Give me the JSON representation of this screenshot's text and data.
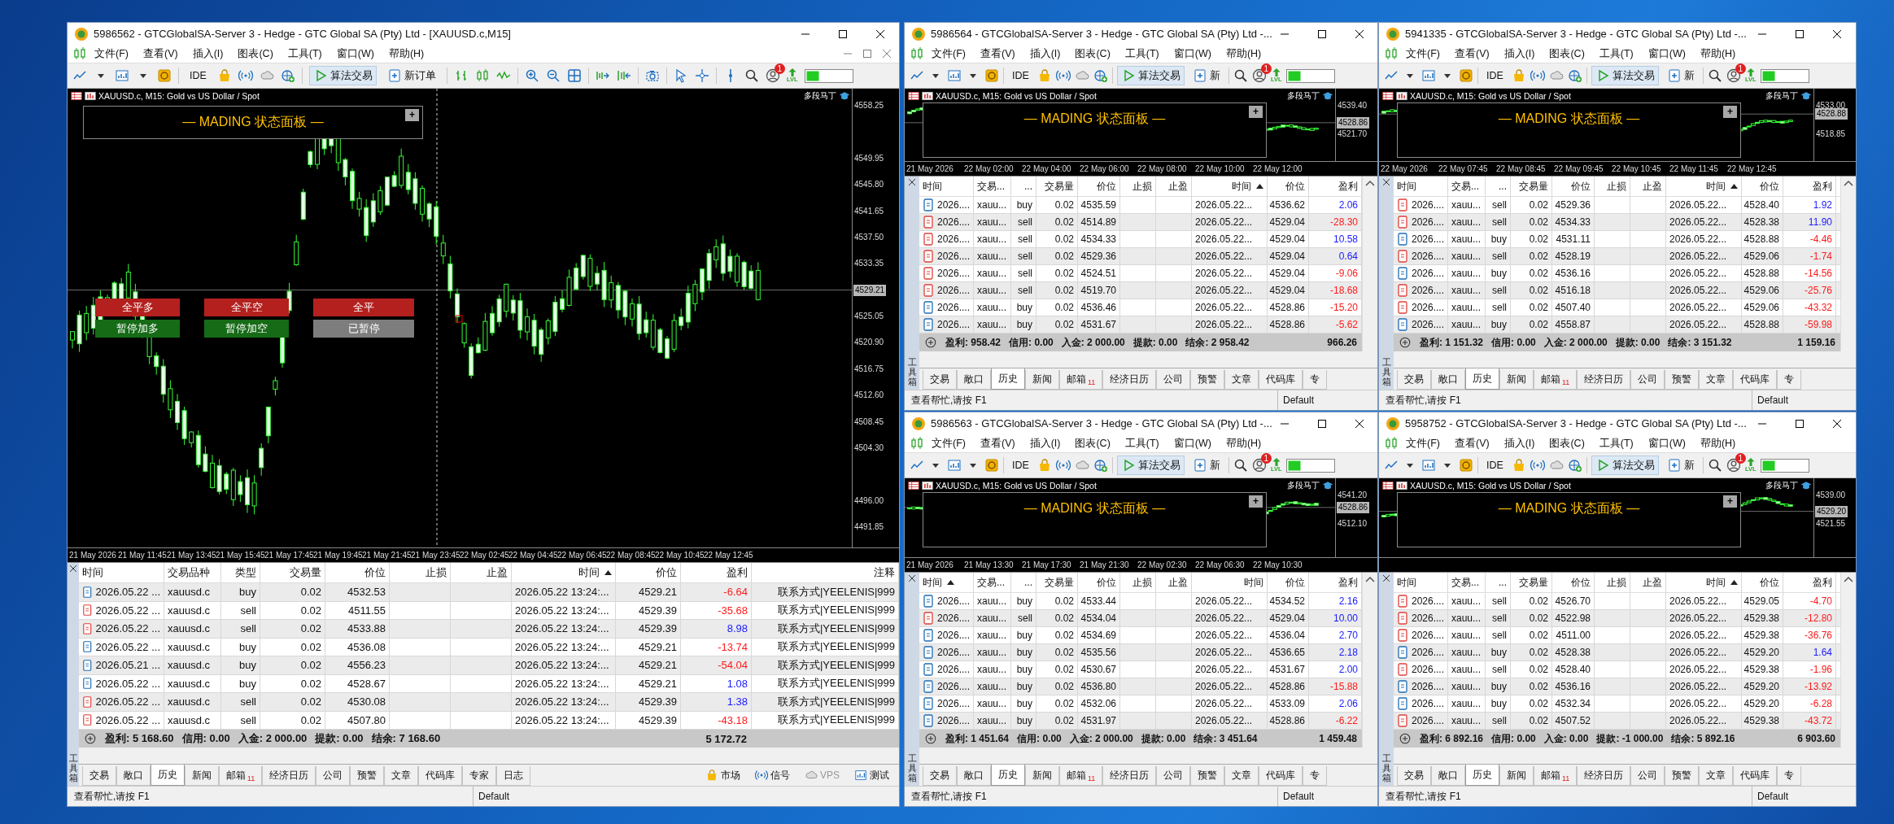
{
  "windows": [
    {
      "kind": "main",
      "title": "5986562 - GTCGlobalSA-Server 3 - Hedge - GTC Global SA (Pty) Ltd - [XAUUSD.c,M15]",
      "menu": [
        "文件(F)",
        "查看(V)",
        "插入(I)",
        "图表(C)",
        "工具(T)",
        "窗口(W)",
        "帮助(H)"
      ],
      "toolbar": {
        "ide": "IDE",
        "algo": "算法交易",
        "order": "新订单",
        "notifications": "1",
        "lvl": "LVL"
      },
      "chart": {
        "symbol": "XAUUSD.c, M15:  Gold vs US Dollar / Spot",
        "expert": "多段马丁",
        "panel_title": "— MADING 状态面板 —",
        "panel_button": "+",
        "prices": [
          "4558.25",
          "4549.95",
          "4545.80",
          "4541.65",
          "4537.50",
          "4533.35",
          "4525.05",
          "4520.90",
          "4516.75",
          "4512.60",
          "4508.45",
          "4504.30",
          "4496.00",
          "4491.85"
        ],
        "current_price": "4529.21",
        "times": [
          "21 May 2026",
          "21 May 11:45",
          "21 May 13:45",
          "21 May 15:45",
          "21 May 17:45",
          "21 May 19:45",
          "21 May 21:45",
          "21 May 23:45",
          "22 May 02:45",
          "22 May 04:45",
          "22 May 06:45",
          "22 May 08:45",
          "22 May 10:45",
          "22 May 12:45"
        ],
        "buttons": [
          {
            "label": "全平多",
            "kind": "close"
          },
          {
            "label": "全平空",
            "kind": "close"
          },
          {
            "label": "全平",
            "kind": "close"
          },
          {
            "label": "暂停加多",
            "kind": "pause"
          },
          {
            "label": "暂停加空",
            "kind": "pause"
          },
          {
            "label": "已暂停",
            "kind": "paused"
          }
        ]
      },
      "table": {
        "columns": [
          {
            "label": "时间",
            "sorted": false
          },
          {
            "label": "交易品种",
            "sorted": false
          },
          {
            "label": "类型",
            "sorted": false
          },
          {
            "label": "交易量",
            "sorted": false
          },
          {
            "label": "价位",
            "sorted": false
          },
          {
            "label": "止损",
            "sorted": false
          },
          {
            "label": "止盈",
            "sorted": false
          },
          {
            "label": "时间",
            "sorted": true
          },
          {
            "label": "价位",
            "sorted": false
          },
          {
            "label": "盈利",
            "sorted": false
          },
          {
            "label": "注释",
            "sorted": false
          }
        ],
        "rows": [
          {
            "time": "2026.05.22 ...",
            "symbol": "xauusd.c",
            "type": "buy",
            "long": true,
            "volume": "0.02",
            "price": "4532.53",
            "close_time": "2026.05.22 13:24:...",
            "close_price": "4529.21",
            "profit": "-6.64",
            "loss": true,
            "comment": "联系方式|YEELENIS|999"
          },
          {
            "time": "2026.05.22 ...",
            "symbol": "xauusd.c",
            "type": "sell",
            "long": false,
            "volume": "0.02",
            "price": "4511.55",
            "close_time": "2026.05.22 13:24:...",
            "close_price": "4529.39",
            "profit": "-35.68",
            "loss": true,
            "comment": "联系方式|YEELENIS|999"
          },
          {
            "time": "2026.05.22 ...",
            "symbol": "xauusd.c",
            "type": "sell",
            "long": false,
            "volume": "0.02",
            "price": "4533.88",
            "close_time": "2026.05.22 13:24:...",
            "close_price": "4529.39",
            "profit": "8.98",
            "loss": false,
            "comment": "联系方式|YEELENIS|999"
          },
          {
            "time": "2026.05.22 ...",
            "symbol": "xauusd.c",
            "type": "buy",
            "long": true,
            "volume": "0.02",
            "price": "4536.08",
            "close_time": "2026.05.22 13:24:...",
            "close_price": "4529.21",
            "profit": "-13.74",
            "loss": true,
            "comment": "联系方式|YEELENIS|999"
          },
          {
            "time": "2026.05.21 ...",
            "symbol": "xauusd.c",
            "type": "buy",
            "long": true,
            "volume": "0.02",
            "price": "4556.23",
            "close_time": "2026.05.22 13:24:...",
            "close_price": "4529.21",
            "profit": "-54.04",
            "loss": true,
            "comment": "联系方式|YEELENIS|999"
          },
          {
            "time": "2026.05.22 ...",
            "symbol": "xauusd.c",
            "type": "buy",
            "long": true,
            "volume": "0.02",
            "price": "4528.67",
            "close_time": "2026.05.22 13:24:...",
            "close_price": "4529.21",
            "profit": "1.08",
            "loss": false,
            "comment": "联系方式|YEELENIS|999"
          },
          {
            "time": "2026.05.22 ...",
            "symbol": "xauusd.c",
            "type": "sell",
            "long": false,
            "volume": "0.02",
            "price": "4530.08",
            "close_time": "2026.05.22 13:24:...",
            "close_price": "4529.39",
            "profit": "1.38",
            "loss": false,
            "comment": "联系方式|YEELENIS|999"
          },
          {
            "time": "2026.05.22 ...",
            "symbol": "xauusd.c",
            "type": "sell",
            "long": false,
            "volume": "0.02",
            "price": "4507.80",
            "close_time": "2026.05.22 13:24:...",
            "close_price": "4529.39",
            "profit": "-43.18",
            "loss": true,
            "comment": "联系方式|YEELENIS|999"
          }
        ],
        "summary": [
          "盈利: 5 168.60",
          "信用: 0.00",
          "入金: 2 000.00",
          "提款: 0.00",
          "结余: 7 168.60"
        ],
        "total": "5 172.72"
      },
      "toolbox": "工具箱",
      "tabs": [
        {
          "label": "交易",
          "selected": false
        },
        {
          "label": "敞口",
          "selected": false
        },
        {
          "label": "历史",
          "selected": true
        },
        {
          "label": "新闻",
          "selected": false
        },
        {
          "label": "邮箱",
          "badge": "11",
          "selected": false
        },
        {
          "label": "经济日历",
          "selected": false
        },
        {
          "label": "公司",
          "selected": false
        },
        {
          "label": "预警",
          "selected": false
        },
        {
          "label": "文章",
          "selected": false
        },
        {
          "label": "代码库",
          "selected": false
        },
        {
          "label": "专家",
          "selected": false
        },
        {
          "label": "日志",
          "selected": false
        }
      ],
      "side_tabs": [
        {
          "label": "市场",
          "disabled": false
        },
        {
          "label": "信号",
          "disabled": false
        },
        {
          "label": "VPS",
          "disabled": true
        },
        {
          "label": "测试",
          "disabled": false
        }
      ],
      "status": {
        "help": "查看帮忙,请按 F1",
        "profile": "Default"
      }
    },
    {
      "kind": "small",
      "title": "5986564 - GTCGlobalSA-Server 3 - Hedge - GTC Global SA (Pty) Ltd -...",
      "menu": [
        "文件(F)",
        "查看(V)",
        "插入(I)",
        "图表(C)",
        "工具(T)",
        "窗口(W)",
        "帮助(H)"
      ],
      "toolbar": {
        "ide": "IDE",
        "algo": "算法交易",
        "order": "新",
        "notifications": "1",
        "lvl": "LVL"
      },
      "chart": {
        "symbol": "XAUUSD.c, M15:  Gold vs US Dollar / Spot",
        "expert": "多段马丁",
        "panel_title": "— MADING 状态面板 —",
        "panel_button": "+",
        "prices": [
          "4539.40",
          "4521.70"
        ],
        "current_price": "4528.86",
        "times": [
          "21 May 2026",
          "22 May 02:00",
          "22 May 04:00",
          "22 May 06:00",
          "22 May 08:00",
          "22 May 10:00",
          "22 May 12:00"
        ]
      },
      "table": {
        "columns": [
          {
            "label": "时间",
            "sorted": false
          },
          {
            "label": "交易...",
            "sorted": false
          },
          {
            "label": "...",
            "sorted": false
          },
          {
            "label": "交易量",
            "sorted": false
          },
          {
            "label": "价位",
            "sorted": false
          },
          {
            "label": "止损",
            "sorted": false
          },
          {
            "label": "止盈",
            "sorted": false
          },
          {
            "label": "时间",
            "sorted": true
          },
          {
            "label": "价位",
            "sorted": false
          },
          {
            "label": "盈利",
            "sorted": false
          }
        ],
        "rows": [
          {
            "time": "2026....",
            "symbol": "xauu...",
            "type": "buy",
            "long": true,
            "volume": "0.02",
            "price": "4535.59",
            "close_time": "2026.05.22...",
            "close_price": "4536.62",
            "profit": "2.06",
            "loss": false
          },
          {
            "time": "2026....",
            "symbol": "xauu...",
            "type": "sell",
            "long": false,
            "volume": "0.02",
            "price": "4514.89",
            "close_time": "2026.05.22...",
            "close_price": "4529.04",
            "profit": "-28.30",
            "loss": true
          },
          {
            "time": "2026....",
            "symbol": "xauu...",
            "type": "sell",
            "long": false,
            "volume": "0.02",
            "price": "4534.33",
            "close_time": "2026.05.22...",
            "close_price": "4529.04",
            "profit": "10.58",
            "loss": false
          },
          {
            "time": "2026....",
            "symbol": "xauu...",
            "type": "sell",
            "long": false,
            "volume": "0.02",
            "price": "4529.36",
            "close_time": "2026.05.22...",
            "close_price": "4529.04",
            "profit": "0.64",
            "loss": false
          },
          {
            "time": "2026....",
            "symbol": "xauu...",
            "type": "sell",
            "long": false,
            "volume": "0.02",
            "price": "4524.51",
            "close_time": "2026.05.22...",
            "close_price": "4529.04",
            "profit": "-9.06",
            "loss": true
          },
          {
            "time": "2026....",
            "symbol": "xauu...",
            "type": "sell",
            "long": false,
            "volume": "0.02",
            "price": "4519.70",
            "close_time": "2026.05.22...",
            "close_price": "4529.04",
            "profit": "-18.68",
            "loss": true
          },
          {
            "time": "2026....",
            "symbol": "xauu...",
            "type": "buy",
            "long": true,
            "volume": "0.02",
            "price": "4536.46",
            "close_time": "2026.05.22...",
            "close_price": "4528.86",
            "profit": "-15.20",
            "loss": true
          },
          {
            "time": "2026....",
            "symbol": "xauu...",
            "type": "buy",
            "long": true,
            "volume": "0.02",
            "price": "4531.67",
            "close_time": "2026.05.22...",
            "close_price": "4528.86",
            "profit": "-5.62",
            "loss": true
          }
        ],
        "summary": [
          "盈利: 958.42",
          "信用: 0.00",
          "入金: 2 000.00",
          "提款: 0.00",
          "结余: 2 958.42"
        ],
        "total": "966.26"
      },
      "toolbox": "工具箱",
      "tabs": [
        {
          "label": "交易",
          "selected": false
        },
        {
          "label": "敞口",
          "selected": false
        },
        {
          "label": "历史",
          "selected": true
        },
        {
          "label": "新闻",
          "selected": false
        },
        {
          "label": "邮箱",
          "badge": "11",
          "selected": false
        },
        {
          "label": "经济日历",
          "selected": false
        },
        {
          "label": "公司",
          "selected": false
        },
        {
          "label": "预警",
          "selected": false
        },
        {
          "label": "文章",
          "selected": false
        },
        {
          "label": "代码库",
          "selected": false
        },
        {
          "label": "专",
          "selected": false
        }
      ],
      "status": {
        "help": "查看帮忙,请按 F1",
        "profile": "Default"
      }
    },
    {
      "kind": "small",
      "title": "5941335 - GTCGlobalSA-Server 3 - Hedge - GTC Global SA (Pty) Ltd -...",
      "menu": [
        "文件(F)",
        "查看(V)",
        "插入(I)",
        "图表(C)",
        "工具(T)",
        "窗口(W)",
        "帮助(H)"
      ],
      "toolbar": {
        "ide": "IDE",
        "algo": "算法交易",
        "order": "新",
        "notifications": "1",
        "lvl": "LVL"
      },
      "chart": {
        "symbol": "XAUUSD.c, M15:  Gold vs US Dollar / Spot",
        "expert": "多段马丁",
        "panel_title": "— MADING 状态面板 —",
        "panel_button": "+",
        "prices": [
          "4533.00",
          "4518.85"
        ],
        "current_price": "4528.88",
        "times": [
          "22 May 2026",
          "22 May 07:45",
          "22 May 08:45",
          "22 May 09:45",
          "22 May 10:45",
          "22 May 11:45",
          "22 May 12:45"
        ]
      },
      "table": {
        "columns": [
          {
            "label": "时间",
            "sorted": false
          },
          {
            "label": "交易...",
            "sorted": false
          },
          {
            "label": "...",
            "sorted": false
          },
          {
            "label": "交易量",
            "sorted": false
          },
          {
            "label": "价位",
            "sorted": false
          },
          {
            "label": "止损",
            "sorted": false
          },
          {
            "label": "止盈",
            "sorted": false
          },
          {
            "label": "时间",
            "sorted": true
          },
          {
            "label": "价位",
            "sorted": false
          },
          {
            "label": "盈利",
            "sorted": false
          }
        ],
        "rows": [
          {
            "time": "2026....",
            "symbol": "xauu...",
            "type": "sell",
            "long": false,
            "volume": "0.02",
            "price": "4529.36",
            "close_time": "2026.05.22...",
            "close_price": "4528.40",
            "profit": "1.92",
            "loss": false
          },
          {
            "time": "2026....",
            "symbol": "xauu...",
            "type": "sell",
            "long": false,
            "volume": "0.02",
            "price": "4534.33",
            "close_time": "2026.05.22...",
            "close_price": "4528.38",
            "profit": "11.90",
            "loss": false
          },
          {
            "time": "2026....",
            "symbol": "xauu...",
            "type": "buy",
            "long": true,
            "volume": "0.02",
            "price": "4531.11",
            "close_time": "2026.05.22...",
            "close_price": "4528.88",
            "profit": "-4.46",
            "loss": true
          },
          {
            "time": "2026....",
            "symbol": "xauu...",
            "type": "sell",
            "long": false,
            "volume": "0.02",
            "price": "4528.19",
            "close_time": "2026.05.22...",
            "close_price": "4529.06",
            "profit": "-1.74",
            "loss": true
          },
          {
            "time": "2026....",
            "symbol": "xauu...",
            "type": "buy",
            "long": true,
            "volume": "0.02",
            "price": "4536.16",
            "close_time": "2026.05.22...",
            "close_price": "4528.88",
            "profit": "-14.56",
            "loss": true
          },
          {
            "time": "2026....",
            "symbol": "xauu...",
            "type": "sell",
            "long": false,
            "volume": "0.02",
            "price": "4516.18",
            "close_time": "2026.05.22...",
            "close_price": "4529.06",
            "profit": "-25.76",
            "loss": true
          },
          {
            "time": "2026....",
            "symbol": "xauu...",
            "type": "sell",
            "long": false,
            "volume": "0.02",
            "price": "4507.40",
            "close_time": "2026.05.22...",
            "close_price": "4529.06",
            "profit": "-43.32",
            "loss": true
          },
          {
            "time": "2026....",
            "symbol": "xauu...",
            "type": "buy",
            "long": true,
            "volume": "0.02",
            "price": "4558.87",
            "close_time": "2026.05.22...",
            "close_price": "4528.88",
            "profit": "-59.98",
            "loss": true
          }
        ],
        "summary": [
          "盈利: 1 151.32",
          "信用: 0.00",
          "入金: 2 000.00",
          "提款: 0.00",
          "结余: 3 151.32"
        ],
        "total": "1 159.16"
      },
      "toolbox": "工具箱",
      "tabs": [
        {
          "label": "交易",
          "selected": false
        },
        {
          "label": "敞口",
          "selected": false
        },
        {
          "label": "历史",
          "selected": true
        },
        {
          "label": "新闻",
          "selected": false
        },
        {
          "label": "邮箱",
          "badge": "11",
          "selected": false
        },
        {
          "label": "经济日历",
          "selected": false
        },
        {
          "label": "公司",
          "selected": false
        },
        {
          "label": "预警",
          "selected": false
        },
        {
          "label": "文章",
          "selected": false
        },
        {
          "label": "代码库",
          "selected": false
        },
        {
          "label": "专",
          "selected": false
        }
      ],
      "status": {
        "help": "查看帮忙,请按 F1",
        "profile": "Default"
      }
    },
    {
      "kind": "small",
      "title": "5986563 - GTCGlobalSA-Server 3 - Hedge - GTC Global SA (Pty) Ltd -...",
      "menu": [
        "文件(F)",
        "查看(V)",
        "插入(I)",
        "图表(C)",
        "工具(T)",
        "窗口(W)",
        "帮助(H)"
      ],
      "toolbar": {
        "ide": "IDE",
        "algo": "算法交易",
        "order": "新",
        "notifications": "1",
        "lvl": "LVL"
      },
      "chart": {
        "symbol": "XAUUSD.c, M15:  Gold vs US Dollar / Spot",
        "expert": "多段马丁",
        "panel_title": "— MADING 状态面板 —",
        "panel_button": "+",
        "prices": [
          "4541.20",
          "4512.10"
        ],
        "current_price": "4528.86",
        "times": [
          "21 May 2026",
          "21 May 13:30",
          "21 May 17:30",
          "21 May 21:30",
          "22 May 02:30",
          "22 May 06:30",
          "22 May 10:30"
        ]
      },
      "table": {
        "columns": [
          {
            "label": "时间",
            "sorted": true
          },
          {
            "label": "交易...",
            "sorted": false
          },
          {
            "label": "...",
            "sorted": false
          },
          {
            "label": "交易量",
            "sorted": false
          },
          {
            "label": "价位",
            "sorted": false
          },
          {
            "label": "止损",
            "sorted": false
          },
          {
            "label": "止盈",
            "sorted": false
          },
          {
            "label": "时间",
            "sorted": false
          },
          {
            "label": "价位",
            "sorted": false
          },
          {
            "label": "盈利",
            "sorted": false
          }
        ],
        "rows": [
          {
            "time": "2026....",
            "symbol": "xauu...",
            "type": "buy",
            "long": true,
            "volume": "0.02",
            "price": "4533.44",
            "close_time": "2026.05.22...",
            "close_price": "4534.52",
            "profit": "2.16",
            "loss": false
          },
          {
            "time": "2026....",
            "symbol": "xauu...",
            "type": "sell",
            "long": false,
            "volume": "0.02",
            "price": "4534.04",
            "close_time": "2026.05.22...",
            "close_price": "4529.04",
            "profit": "10.00",
            "loss": false
          },
          {
            "time": "2026....",
            "symbol": "xauu...",
            "type": "buy",
            "long": true,
            "volume": "0.02",
            "price": "4534.69",
            "close_time": "2026.05.22...",
            "close_price": "4536.04",
            "profit": "2.70",
            "loss": false
          },
          {
            "time": "2026....",
            "symbol": "xauu...",
            "type": "buy",
            "long": true,
            "volume": "0.02",
            "price": "4535.56",
            "close_time": "2026.05.22...",
            "close_price": "4536.65",
            "profit": "2.18",
            "loss": false
          },
          {
            "time": "2026....",
            "symbol": "xauu...",
            "type": "buy",
            "long": true,
            "volume": "0.02",
            "price": "4530.67",
            "close_time": "2026.05.22...",
            "close_price": "4531.67",
            "profit": "2.00",
            "loss": false
          },
          {
            "time": "2026....",
            "symbol": "xauu...",
            "type": "buy",
            "long": true,
            "volume": "0.02",
            "price": "4536.80",
            "close_time": "2026.05.22...",
            "close_price": "4528.86",
            "profit": "-15.88",
            "loss": true
          },
          {
            "time": "2026....",
            "symbol": "xauu...",
            "type": "buy",
            "long": true,
            "volume": "0.02",
            "price": "4532.06",
            "close_time": "2026.05.22...",
            "close_price": "4533.09",
            "profit": "2.06",
            "loss": false
          },
          {
            "time": "2026....",
            "symbol": "xauu...",
            "type": "buy",
            "long": true,
            "volume": "0.02",
            "price": "4531.97",
            "close_time": "2026.05.22...",
            "close_price": "4528.86",
            "profit": "-6.22",
            "loss": true
          }
        ],
        "summary": [
          "盈利: 1 451.64",
          "信用: 0.00",
          "入金: 2 000.00",
          "提款: 0.00",
          "结余: 3 451.64"
        ],
        "total": "1 459.48"
      },
      "toolbox": "工具箱",
      "tabs": [
        {
          "label": "交易",
          "selected": false
        },
        {
          "label": "敞口",
          "selected": false
        },
        {
          "label": "历史",
          "selected": true
        },
        {
          "label": "新闻",
          "selected": false
        },
        {
          "label": "邮箱",
          "badge": "11",
          "selected": false
        },
        {
          "label": "经济日历",
          "selected": false
        },
        {
          "label": "公司",
          "selected": false
        },
        {
          "label": "预警",
          "selected": false
        },
        {
          "label": "文章",
          "selected": false
        },
        {
          "label": "代码库",
          "selected": false
        },
        {
          "label": "专",
          "selected": false
        }
      ],
      "status": {
        "help": "查看帮忙,请按 F1",
        "profile": "Default"
      }
    },
    {
      "kind": "small",
      "title": "5958752 - GTCGlobalSA-Server 3 - Hedge - GTC Global SA (Pty) Ltd -...",
      "menu": [
        "文件(F)",
        "查看(V)",
        "插入(I)",
        "图表(C)",
        "工具(T)",
        "窗口(W)",
        "帮助(H)"
      ],
      "toolbar": {
        "ide": "IDE",
        "algo": "算法交易",
        "order": "新",
        "notifications": "1",
        "lvl": "LVL"
      },
      "chart": {
        "symbol": "XAUUSD.c, M15:  Gold vs US Dollar / Spot",
        "expert": "多段马丁",
        "panel_title": "— MADING 状态面板 —",
        "panel_button": "+",
        "prices": [
          "4539.00",
          "4521.55"
        ],
        "current_price": "4529.20"
      },
      "table": {
        "columns": [
          {
            "label": "时间",
            "sorted": false
          },
          {
            "label": "交易...",
            "sorted": false
          },
          {
            "label": "...",
            "sorted": false
          },
          {
            "label": "交易量",
            "sorted": false
          },
          {
            "label": "价位",
            "sorted": false
          },
          {
            "label": "止损",
            "sorted": false
          },
          {
            "label": "止盈",
            "sorted": false
          },
          {
            "label": "时间",
            "sorted": true
          },
          {
            "label": "价位",
            "sorted": false
          },
          {
            "label": "盈利",
            "sorted": false
          }
        ],
        "rows": [
          {
            "time": "2026....",
            "symbol": "xauu...",
            "type": "sell",
            "long": false,
            "volume": "0.02",
            "price": "4526.70",
            "close_time": "2026.05.22...",
            "close_price": "4529.05",
            "profit": "-4.70",
            "loss": true
          },
          {
            "time": "2026....",
            "symbol": "xauu...",
            "type": "sell",
            "long": false,
            "volume": "0.02",
            "price": "4522.98",
            "close_time": "2026.05.22...",
            "close_price": "4529.38",
            "profit": "-12.80",
            "loss": true
          },
          {
            "time": "2026....",
            "symbol": "xauu...",
            "type": "sell",
            "long": false,
            "volume": "0.02",
            "price": "4511.00",
            "close_time": "2026.05.22...",
            "close_price": "4529.38",
            "profit": "-36.76",
            "loss": true
          },
          {
            "time": "2026....",
            "symbol": "xauu...",
            "type": "buy",
            "long": true,
            "volume": "0.02",
            "price": "4528.38",
            "close_time": "2026.05.22...",
            "close_price": "4529.20",
            "profit": "1.64",
            "loss": false
          },
          {
            "time": "2026....",
            "symbol": "xauu...",
            "type": "sell",
            "long": false,
            "volume": "0.02",
            "price": "4528.40",
            "close_time": "2026.05.22...",
            "close_price": "4529.38",
            "profit": "-1.96",
            "loss": true
          },
          {
            "time": "2026....",
            "symbol": "xauu...",
            "type": "buy",
            "long": true,
            "volume": "0.02",
            "price": "4536.16",
            "close_time": "2026.05.22...",
            "close_price": "4529.20",
            "profit": "-13.92",
            "loss": true
          },
          {
            "time": "2026....",
            "symbol": "xauu...",
            "type": "buy",
            "long": true,
            "volume": "0.02",
            "price": "4532.34",
            "close_time": "2026.05.22...",
            "close_price": "4529.20",
            "profit": "-6.28",
            "loss": true
          },
          {
            "time": "2026....",
            "symbol": "xauu...",
            "type": "sell",
            "long": false,
            "volume": "0.02",
            "price": "4507.52",
            "close_time": "2026.05.22...",
            "close_price": "4529.38",
            "profit": "-43.72",
            "loss": true
          }
        ],
        "summary": [
          "盈利: 6 892.16",
          "信用: 0.00",
          "入金: 0.00",
          "提款: -1 000.00",
          "结余: 5 892.16"
        ],
        "total": "6 903.60"
      },
      "toolbox": "工具箱",
      "tabs": [
        {
          "label": "交易",
          "selected": false
        },
        {
          "label": "敞口",
          "selected": false
        },
        {
          "label": "历史",
          "selected": true
        },
        {
          "label": "新闻",
          "selected": false
        },
        {
          "label": "邮箱",
          "badge": "11",
          "selected": false
        },
        {
          "label": "经济日历",
          "selected": false
        },
        {
          "label": "公司",
          "selected": false
        },
        {
          "label": "预警",
          "selected": false
        },
        {
          "label": "文章",
          "selected": false
        },
        {
          "label": "代码库",
          "selected": false
        },
        {
          "label": "专",
          "selected": false
        }
      ],
      "status": {
        "help": "查看帮忙,请按 F1",
        "profile": "Default"
      }
    }
  ]
}
